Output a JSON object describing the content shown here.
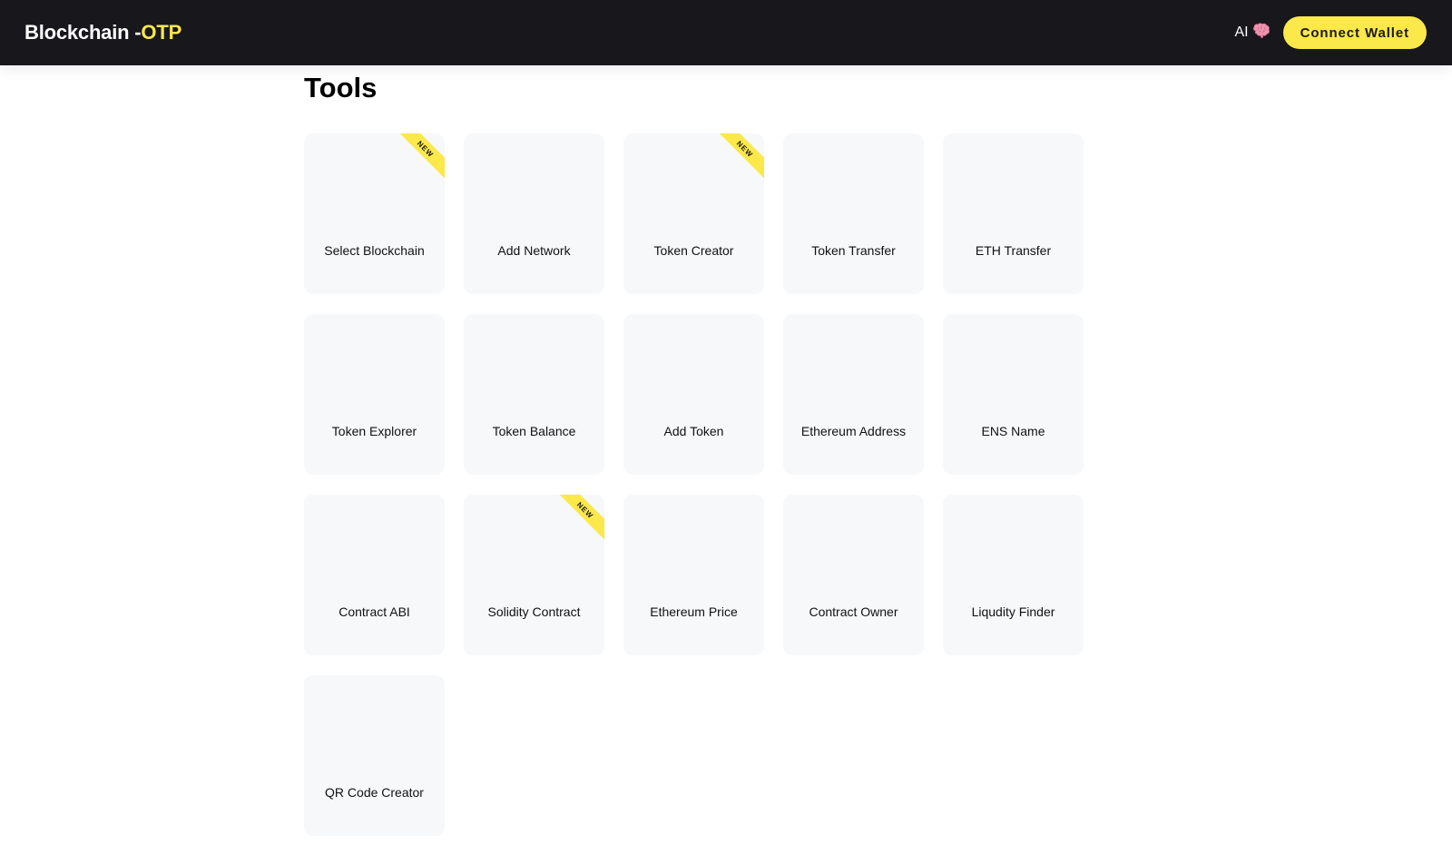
{
  "header": {
    "brand_main": "Blockchain -",
    "brand_accent": "OTP",
    "ai_label": "AI",
    "ai_icon": "brain-icon",
    "connect_label": "Connect Wallet"
  },
  "page": {
    "title": "Tools"
  },
  "colors": {
    "accent": "#fbe84a",
    "header_bg": "#17171c",
    "card_bg": "#f7f8fa"
  },
  "tools": [
    {
      "label": "Select Blockchain",
      "badge": "NEW"
    },
    {
      "label": "Add Network",
      "badge": ""
    },
    {
      "label": "Token Creator",
      "badge": "NEW"
    },
    {
      "label": "Token Transfer",
      "badge": ""
    },
    {
      "label": "ETH Transfer",
      "badge": ""
    },
    {
      "label": "Token Explorer",
      "badge": ""
    },
    {
      "label": "Token Balance",
      "badge": ""
    },
    {
      "label": "Add Token",
      "badge": ""
    },
    {
      "label": "Ethereum Address",
      "badge": ""
    },
    {
      "label": "ENS Name",
      "badge": ""
    },
    {
      "label": "Contract ABI",
      "badge": ""
    },
    {
      "label": "Solidity Contract",
      "badge": "NEW"
    },
    {
      "label": "Ethereum Price",
      "badge": ""
    },
    {
      "label": "Contract Owner",
      "badge": ""
    },
    {
      "label": "Liqudity Finder",
      "badge": ""
    },
    {
      "label": "QR Code Creator",
      "badge": ""
    }
  ]
}
